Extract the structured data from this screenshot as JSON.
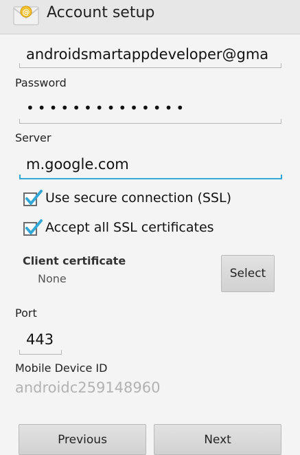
{
  "action_bar": {
    "title": "Account setup",
    "icon": "email-envelope-icon"
  },
  "form": {
    "username_value": "androidsmartappdeveloper@gma",
    "password_label": "Password",
    "password_value": "••••••••••••••",
    "server_label": "Server",
    "server_value": "m.google.com",
    "ssl_checkbox": {
      "label": "Use secure connection (SSL)",
      "checked": true
    },
    "accept_certs_checkbox": {
      "label": "Accept all SSL certificates",
      "checked": true
    },
    "client_cert_label": "Client certificate",
    "client_cert_value": "None",
    "select_button": "Select",
    "port_label": "Port",
    "port_value": "443",
    "device_id_label": "Mobile Device ID",
    "device_id_value": "androidc259148960"
  },
  "footer": {
    "previous_button": "Previous",
    "next_button": "Next"
  },
  "colors": {
    "accent": "#33a7d6",
    "checkbox_check": "#33a7d6"
  }
}
